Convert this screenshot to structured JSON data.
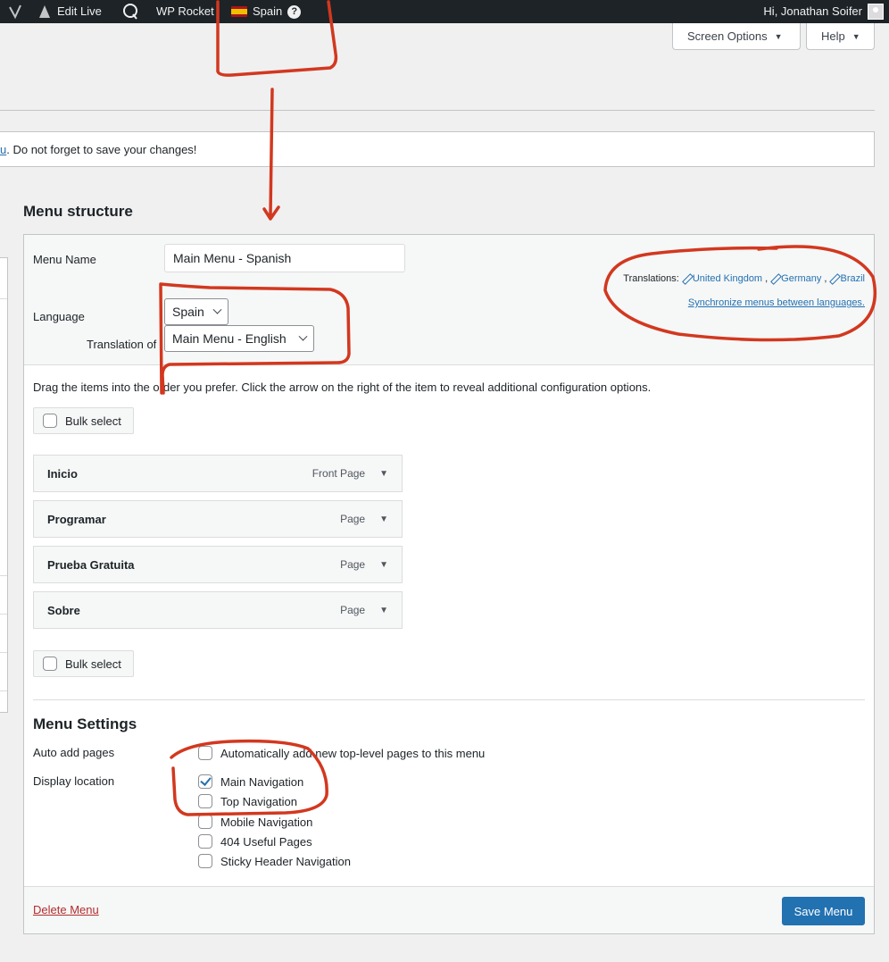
{
  "adminbar": {
    "edit_live": "Edit Live",
    "wp_rocket": "WP Rocket",
    "language": "Spain",
    "help": "?",
    "greeting": "Hi, Jonathan Soifer"
  },
  "screen_options": "Screen Options",
  "help_tab": "Help",
  "notice": {
    "link_fragment": "u",
    "text": ". Do not forget to save your changes!"
  },
  "menu_structure_title": "Menu structure",
  "menu_name_label": "Menu Name",
  "menu_name_value": "Main Menu - Spanish",
  "language_label": "Language",
  "language_value": "Spain",
  "translation_of_label": "Translation of",
  "translation_of_value": "Main Menu - English",
  "translations": {
    "label": "Translations:",
    "links": [
      "United Kingdom",
      "Germany",
      "Brazil"
    ],
    "sync": "Synchronize menus between languages."
  },
  "instructions": "Drag the items into the order you prefer. Click the arrow on the right of the item to reveal additional configuration options.",
  "bulk_select": "Bulk select",
  "menu_items": [
    {
      "title": "Inicio",
      "type": "Front Page"
    },
    {
      "title": "Programar",
      "type": "Page"
    },
    {
      "title": "Prueba Gratuita",
      "type": "Page"
    },
    {
      "title": "Sobre",
      "type": "Page"
    }
  ],
  "menu_settings": {
    "title": "Menu Settings",
    "auto_add_label": "Auto add pages",
    "auto_add_option": "Automatically add new top-level pages to this menu",
    "display_location_label": "Display location",
    "locations": [
      {
        "label": "Main Navigation",
        "checked": true
      },
      {
        "label": "Top Navigation",
        "checked": false
      },
      {
        "label": "Mobile Navigation",
        "checked": false
      },
      {
        "label": "404 Useful Pages",
        "checked": false
      },
      {
        "label": "Sticky Header Navigation",
        "checked": false
      }
    ]
  },
  "delete_menu": "Delete Menu",
  "save_menu": "Save Menu",
  "colors": {
    "adminbar": "#1d2327",
    "link": "#2271b1",
    "primary_button": "#2271b1",
    "delete": "#b32d2e",
    "annotation": "#d2381f"
  }
}
